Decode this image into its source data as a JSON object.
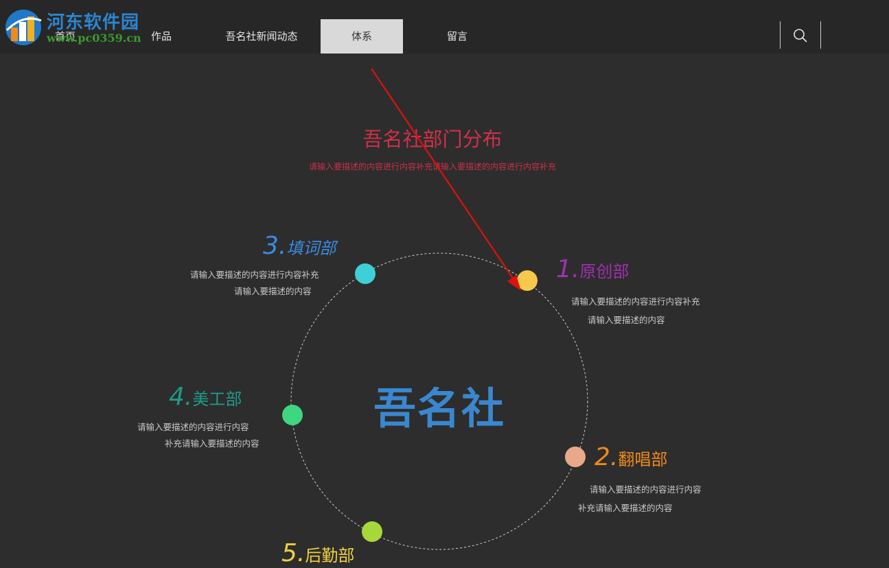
{
  "watermark": {
    "name": "河东软件园",
    "url": "www.pc0359.cn"
  },
  "nav": {
    "items": [
      {
        "label": "首页"
      },
      {
        "label": "作品"
      },
      {
        "label": "吾名社新闻动态"
      },
      {
        "label": "体系",
        "active": true
      },
      {
        "label": "留言"
      }
    ],
    "search_icon": "search-icon"
  },
  "section": {
    "title": "吾名社部门分布",
    "subtitle": "请输入要描述的内容进行内容补充请输入要描述的内容进行内容补充"
  },
  "center": {
    "label": "吾名社"
  },
  "departments": [
    {
      "num": "1.",
      "name": "原创部",
      "desc1": "请输入要描述的内容进行内容补充",
      "desc2": "请输入要描述的内容",
      "text_color": "#a030b0",
      "dot_color": "#f7c94b"
    },
    {
      "num": "2.",
      "name": "翻唱部",
      "desc1": "请输入要描述的内容进行内容",
      "desc2": "补充请输入要描述的内容",
      "text_color": "#f08a1c",
      "dot_color": "#e9a88a"
    },
    {
      "num": "3.",
      "name": "填词部",
      "desc1": "请输入要描述的内容进行内容补充",
      "desc2": "请输入要描述的内容",
      "text_color": "#3a8be0",
      "dot_color": "#3dd0d8"
    },
    {
      "num": "4.",
      "name": "美工部",
      "desc1": "请输入要描述的内容进行内容",
      "desc2": "补充请输入要描述的内容",
      "text_color": "#1e9a8a",
      "dot_color": "#3ed67e"
    },
    {
      "num": "5.",
      "name": "后勤部",
      "desc1": "",
      "desc2": "",
      "text_color": "#f0d040",
      "dot_color": "#a6d83a"
    }
  ],
  "colors": {
    "background": "#2d2d2d",
    "navbar": "#272727",
    "accent_title": "#d0304a",
    "annotation_arrow": "#e01010"
  }
}
